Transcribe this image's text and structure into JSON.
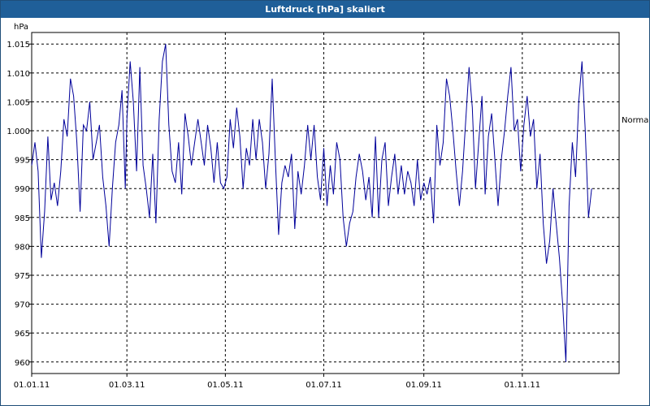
{
  "window": {
    "title": "Luftdruck [hPa] skaliert"
  },
  "chart_data": {
    "type": "line",
    "title": "Luftdruck [hPa] skaliert",
    "ylabel": "hPa",
    "xlabel": "",
    "ylim": [
      958,
      1017
    ],
    "xlim": [
      "2011-01-01",
      "2011-12-31"
    ],
    "grid": true,
    "line_color": "#00009a",
    "y_ticks": [
      {
        "value": 1015,
        "label": "1.015"
      },
      {
        "value": 1010,
        "label": "1.010"
      },
      {
        "value": 1005,
        "label": "1.005"
      },
      {
        "value": 1000,
        "label": "1.000"
      },
      {
        "value": 995,
        "label": "995"
      },
      {
        "value": 990,
        "label": "990"
      },
      {
        "value": 985,
        "label": "985"
      },
      {
        "value": 980,
        "label": "980"
      },
      {
        "value": 975,
        "label": "975"
      },
      {
        "value": 970,
        "label": "970"
      },
      {
        "value": 965,
        "label": "965"
      },
      {
        "value": 960,
        "label": "960"
      }
    ],
    "x_ticks": [
      {
        "date": "2011-01-01",
        "label": "01.01.11"
      },
      {
        "date": "2011-03-01",
        "label": "01.03.11"
      },
      {
        "date": "2011-05-01",
        "label": "01.05.11"
      },
      {
        "date": "2011-07-01",
        "label": "01.07.11"
      },
      {
        "date": "2011-09-01",
        "label": "01.09.11"
      },
      {
        "date": "2011-11-01",
        "label": "01.11.11"
      }
    ],
    "reference_line": {
      "label": "Normal",
      "value": 1002
    },
    "series": [
      {
        "points": [
          [
            "2011-01-01",
            994
          ],
          [
            "2011-01-03",
            998
          ],
          [
            "2011-01-05",
            993
          ],
          [
            "2011-01-07",
            978
          ],
          [
            "2011-01-09",
            986
          ],
          [
            "2011-01-11",
            999
          ],
          [
            "2011-01-13",
            988
          ],
          [
            "2011-01-15",
            991
          ],
          [
            "2011-01-17",
            987
          ],
          [
            "2011-01-19",
            993
          ],
          [
            "2011-01-21",
            1002
          ],
          [
            "2011-01-23",
            999
          ],
          [
            "2011-01-25",
            1009
          ],
          [
            "2011-01-27",
            1006
          ],
          [
            "2011-01-29",
            998
          ],
          [
            "2011-01-31",
            986
          ],
          [
            "2011-02-02",
            1001
          ],
          [
            "2011-02-04",
            1000
          ],
          [
            "2011-02-06",
            1005
          ],
          [
            "2011-02-08",
            995
          ],
          [
            "2011-02-10",
            998
          ],
          [
            "2011-02-12",
            1001
          ],
          [
            "2011-02-14",
            992
          ],
          [
            "2011-02-16",
            987
          ],
          [
            "2011-02-18",
            980
          ],
          [
            "2011-02-20",
            990
          ],
          [
            "2011-02-22",
            998
          ],
          [
            "2011-02-24",
            1001
          ],
          [
            "2011-02-26",
            1007
          ],
          [
            "2011-02-28",
            990
          ],
          [
            "2011-03-01",
            1002
          ],
          [
            "2011-03-03",
            1012
          ],
          [
            "2011-03-05",
            1005
          ],
          [
            "2011-03-07",
            993
          ],
          [
            "2011-03-09",
            1011
          ],
          [
            "2011-03-11",
            994
          ],
          [
            "2011-03-13",
            990
          ],
          [
            "2011-03-15",
            985
          ],
          [
            "2011-03-17",
            996
          ],
          [
            "2011-03-19",
            984
          ],
          [
            "2011-03-21",
            1002
          ],
          [
            "2011-03-23",
            1012
          ],
          [
            "2011-03-25",
            1015
          ],
          [
            "2011-03-27",
            1001
          ],
          [
            "2011-03-29",
            993
          ],
          [
            "2011-03-31",
            991
          ],
          [
            "2011-04-02",
            998
          ],
          [
            "2011-04-04",
            989
          ],
          [
            "2011-04-06",
            1003
          ],
          [
            "2011-04-08",
            999
          ],
          [
            "2011-04-10",
            994
          ],
          [
            "2011-04-12",
            998
          ],
          [
            "2011-04-14",
            1002
          ],
          [
            "2011-04-16",
            998
          ],
          [
            "2011-04-18",
            994
          ],
          [
            "2011-04-20",
            1001
          ],
          [
            "2011-04-22",
            997
          ],
          [
            "2011-04-24",
            991
          ],
          [
            "2011-04-26",
            998
          ],
          [
            "2011-04-28",
            991
          ],
          [
            "2011-04-30",
            990
          ],
          [
            "2011-05-02",
            992
          ],
          [
            "2011-05-04",
            1002
          ],
          [
            "2011-05-06",
            997
          ],
          [
            "2011-05-08",
            1004
          ],
          [
            "2011-05-10",
            999
          ],
          [
            "2011-05-12",
            990
          ],
          [
            "2011-05-14",
            997
          ],
          [
            "2011-05-16",
            994
          ],
          [
            "2011-05-18",
            1002
          ],
          [
            "2011-05-20",
            995
          ],
          [
            "2011-05-22",
            1002
          ],
          [
            "2011-05-24",
            998
          ],
          [
            "2011-05-26",
            990
          ],
          [
            "2011-05-28",
            996
          ],
          [
            "2011-05-30",
            1009
          ],
          [
            "2011-06-01",
            995
          ],
          [
            "2011-06-03",
            982
          ],
          [
            "2011-06-05",
            991
          ],
          [
            "2011-06-07",
            994
          ],
          [
            "2011-06-09",
            992
          ],
          [
            "2011-06-11",
            996
          ],
          [
            "2011-06-13",
            983
          ],
          [
            "2011-06-15",
            993
          ],
          [
            "2011-06-17",
            989
          ],
          [
            "2011-06-19",
            994
          ],
          [
            "2011-06-21",
            1001
          ],
          [
            "2011-06-23",
            995
          ],
          [
            "2011-06-25",
            1001
          ],
          [
            "2011-06-27",
            992
          ],
          [
            "2011-06-29",
            988
          ],
          [
            "2011-07-01",
            997
          ],
          [
            "2011-07-03",
            987
          ],
          [
            "2011-07-05",
            994
          ],
          [
            "2011-07-07",
            989
          ],
          [
            "2011-07-09",
            998
          ],
          [
            "2011-07-11",
            995
          ],
          [
            "2011-07-13",
            985
          ],
          [
            "2011-07-15",
            980
          ],
          [
            "2011-07-17",
            984
          ],
          [
            "2011-07-19",
            986
          ],
          [
            "2011-07-21",
            992
          ],
          [
            "2011-07-23",
            996
          ],
          [
            "2011-07-25",
            993
          ],
          [
            "2011-07-27",
            988
          ],
          [
            "2011-07-29",
            992
          ],
          [
            "2011-07-31",
            985
          ],
          [
            "2011-08-02",
            999
          ],
          [
            "2011-08-04",
            985
          ],
          [
            "2011-08-06",
            995
          ],
          [
            "2011-08-08",
            998
          ],
          [
            "2011-08-10",
            987
          ],
          [
            "2011-08-12",
            992
          ],
          [
            "2011-08-14",
            996
          ],
          [
            "2011-08-16",
            989
          ],
          [
            "2011-08-18",
            994
          ],
          [
            "2011-08-20",
            989
          ],
          [
            "2011-08-22",
            993
          ],
          [
            "2011-08-24",
            991
          ],
          [
            "2011-08-26",
            987
          ],
          [
            "2011-08-28",
            995
          ],
          [
            "2011-08-30",
            988
          ],
          [
            "2011-09-01",
            991
          ],
          [
            "2011-09-03",
            989
          ],
          [
            "2011-09-05",
            992
          ],
          [
            "2011-09-07",
            984
          ],
          [
            "2011-09-09",
            1001
          ],
          [
            "2011-09-11",
            994
          ],
          [
            "2011-09-13",
            998
          ],
          [
            "2011-09-15",
            1009
          ],
          [
            "2011-09-17",
            1006
          ],
          [
            "2011-09-19",
            1000
          ],
          [
            "2011-09-21",
            993
          ],
          [
            "2011-09-23",
            987
          ],
          [
            "2011-09-25",
            993
          ],
          [
            "2011-09-27",
            1002
          ],
          [
            "2011-09-29",
            1011
          ],
          [
            "2011-10-01",
            1004
          ],
          [
            "2011-10-03",
            990
          ],
          [
            "2011-10-05",
            998
          ],
          [
            "2011-10-07",
            1006
          ],
          [
            "2011-10-09",
            989
          ],
          [
            "2011-10-11",
            999
          ],
          [
            "2011-10-13",
            1003
          ],
          [
            "2011-10-15",
            995
          ],
          [
            "2011-10-17",
            987
          ],
          [
            "2011-10-19",
            995
          ],
          [
            "2011-10-21",
            1000
          ],
          [
            "2011-10-23",
            1006
          ],
          [
            "2011-10-25",
            1011
          ],
          [
            "2011-10-27",
            1000
          ],
          [
            "2011-10-29",
            1002
          ],
          [
            "2011-10-31",
            993
          ],
          [
            "2011-11-02",
            1001
          ],
          [
            "2011-11-04",
            1006
          ],
          [
            "2011-11-06",
            999
          ],
          [
            "2011-11-08",
            1002
          ],
          [
            "2011-11-10",
            990
          ],
          [
            "2011-11-12",
            996
          ],
          [
            "2011-11-14",
            984
          ],
          [
            "2011-11-16",
            977
          ],
          [
            "2011-11-18",
            981
          ],
          [
            "2011-11-20",
            990
          ],
          [
            "2011-11-22",
            984
          ],
          [
            "2011-11-24",
            978
          ],
          [
            "2011-11-26",
            970
          ],
          [
            "2011-11-28",
            960
          ],
          [
            "2011-11-30",
            987
          ],
          [
            "2011-12-02",
            998
          ],
          [
            "2011-12-04",
            992
          ],
          [
            "2011-12-06",
            1005
          ],
          [
            "2011-12-08",
            1012
          ],
          [
            "2011-12-10",
            1000
          ],
          [
            "2011-12-12",
            985
          ],
          [
            "2011-12-14",
            990
          ]
        ]
      }
    ]
  }
}
